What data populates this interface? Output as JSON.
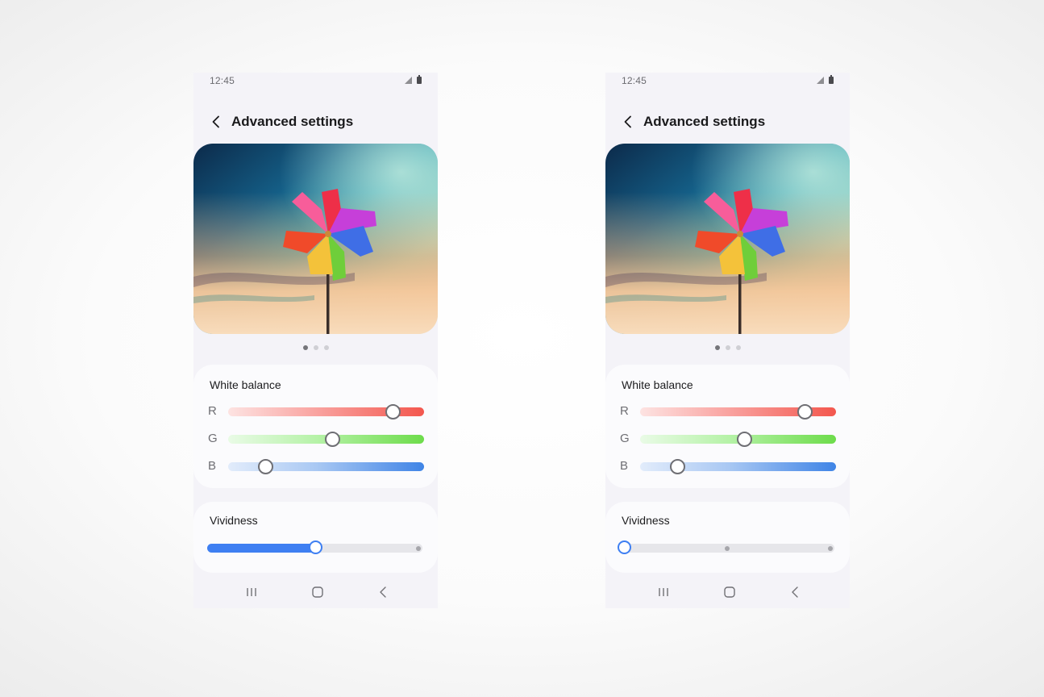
{
  "phones": [
    {
      "id": "left",
      "status": {
        "time": "12:45",
        "icons": [
          "signal-icon",
          "battery-icon"
        ]
      },
      "header": {
        "back_icon": "chevron-left-icon",
        "title": "Advanced settings"
      },
      "preview": {
        "image": "rainbow-pinwheel-sunset",
        "pages": 3,
        "active_page": 1
      },
      "white_balance": {
        "title": "White balance",
        "channels": [
          {
            "label": "R",
            "value": 0.84,
            "color": "#f3574e"
          },
          {
            "label": "G",
            "value": 0.53,
            "color": "#6ddc4b"
          },
          {
            "label": "B",
            "value": 0.19,
            "color": "#3f84e6"
          }
        ]
      },
      "vividness": {
        "title": "Vividness",
        "value": 0.5,
        "steps": [
          0,
          0.5,
          1
        ]
      },
      "nav": {
        "recents_icon": "recents-icon",
        "home_icon": "home-icon",
        "back_icon": "back-icon"
      }
    },
    {
      "id": "right",
      "status": {
        "time": "12:45",
        "icons": [
          "signal-icon",
          "battery-icon"
        ]
      },
      "header": {
        "back_icon": "chevron-left-icon",
        "title": "Advanced settings"
      },
      "preview": {
        "image": "rainbow-pinwheel-sunset",
        "pages": 3,
        "active_page": 1
      },
      "white_balance": {
        "title": "White balance",
        "channels": [
          {
            "label": "R",
            "value": 0.84,
            "color": "#f3574e"
          },
          {
            "label": "G",
            "value": 0.53,
            "color": "#6ddc4b"
          },
          {
            "label": "B",
            "value": 0.19,
            "color": "#3f84e6"
          }
        ]
      },
      "vividness": {
        "title": "Vividness",
        "value": 0.0,
        "steps": [
          0,
          0.5,
          1
        ]
      },
      "nav": {
        "recents_icon": "recents-icon",
        "home_icon": "home-icon",
        "back_icon": "back-icon"
      }
    }
  ],
  "colors": {
    "accent": "#3e7ff2",
    "screen_bg": "#f4f3f8",
    "card_bg": "#fbfbfd",
    "track_bg": "#e6e6ea"
  }
}
